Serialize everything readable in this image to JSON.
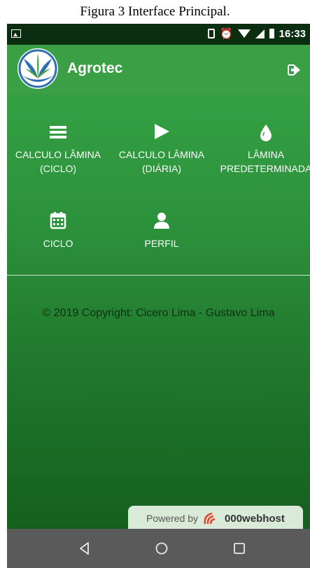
{
  "caption": "Figura 3 Interface Principal.",
  "status_bar": {
    "time": "16:33",
    "icons": [
      "image-icon",
      "vibrate-icon",
      "alarm-icon",
      "wifi-icon",
      "signal-icon",
      "battery-icon"
    ]
  },
  "header": {
    "title": "Agrotec",
    "logo": "agrotec-logo",
    "logout_icon": "logout-icon"
  },
  "menu": [
    {
      "id": "calculo-ciclo",
      "icon": "menu-icon",
      "label": "CALCULO LÂMINA\n(CICLO)"
    },
    {
      "id": "calculo-diaria",
      "icon": "play-icon",
      "label": "CALCULO LÂMINA\n(DIÁRIA)"
    },
    {
      "id": "lamina-predeterminada",
      "icon": "drop-icon",
      "label": "LÂMINA\nPREDETERMINADA"
    },
    {
      "id": "ciclo",
      "icon": "calendar-icon",
      "label": "CICLO"
    },
    {
      "id": "perfil",
      "icon": "user-icon",
      "label": "PERFIL"
    }
  ],
  "footer": {
    "copyright": "© 2019 Copyright: Cicero Lima - Gustavo Lima"
  },
  "powered_by": {
    "prefix": "Powered by",
    "brand": "000webhost"
  },
  "nav_bar": [
    "back-icon",
    "home-icon",
    "recents-icon"
  ],
  "colors": {
    "header": "#3b9f45",
    "body_top": "#34a043",
    "body_bottom": "#165f1f",
    "copyright_text": "#0f2f13"
  }
}
